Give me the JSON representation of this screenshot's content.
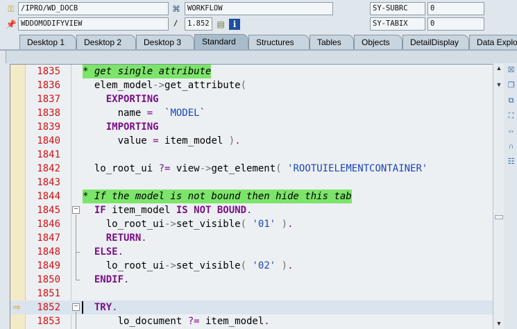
{
  "debugger": {
    "row1": {
      "program": "/IPRO/WD_DOCB",
      "event": "WORKFLOW",
      "sys_field_name": "SY-SUBRC",
      "sys_field_value": "0"
    },
    "row2": {
      "include": "WDDOMODIFYVIEW",
      "separator": "/",
      "line_no": "1.852",
      "sys_field_name": "SY-TABIX",
      "sys_field_value": "0"
    }
  },
  "tabs": [
    "Desktop 1",
    "Desktop 2",
    "Desktop 3",
    "Standard",
    "Structures",
    "Tables",
    "Objects",
    "DetailDisplay",
    "Data Explor"
  ],
  "active_tab": "Standard",
  "editor": {
    "lines": [
      {
        "no": "1835",
        "code": "* get single attribute"
      },
      {
        "no": "1836",
        "code": "  elem_model->get_attribute("
      },
      {
        "no": "1837",
        "code": "    EXPORTING"
      },
      {
        "no": "1838",
        "code": "      name =  `MODEL`"
      },
      {
        "no": "1839",
        "code": "    IMPORTING"
      },
      {
        "no": "1840",
        "code": "      value = item_model )."
      },
      {
        "no": "1841",
        "code": ""
      },
      {
        "no": "1842",
        "code": "  lo_root_ui ?= view->get_element( 'ROOTUIELEMENTCONTAINER'"
      },
      {
        "no": "1843",
        "code": ""
      },
      {
        "no": "1844",
        "code": "* If the model is not bound then hide this tab"
      },
      {
        "no": "1845",
        "code": "  IF item_model IS NOT BOUND."
      },
      {
        "no": "1846",
        "code": "    lo_root_ui->set_visible( '01' )."
      },
      {
        "no": "1847",
        "code": "    RETURN."
      },
      {
        "no": "1848",
        "code": "  ELSE."
      },
      {
        "no": "1849",
        "code": "    lo_root_ui->set_visible( '02' )."
      },
      {
        "no": "1850",
        "code": "  ENDIF."
      },
      {
        "no": "1851",
        "code": ""
      },
      {
        "no": "1852",
        "code": "  TRY."
      },
      {
        "no": "1853",
        "code": "      lo_document ?= item_model."
      }
    ],
    "current_line": "1852"
  },
  "colors": {
    "line_number": "#d31212",
    "keyword": "#7a0f85",
    "string": "#1c44b5",
    "comment_bg": "#7ce46a",
    "editor_bg": "#ecf0f3",
    "gutter_bg": "#f3ebc8"
  },
  "icons": {
    "program": "yellow-lock-icon",
    "include": "pin-icon",
    "event": "workflow-icon",
    "line": "source-icon",
    "info": "info-icon",
    "breakpoint_arrow": "execution-arrow-icon"
  }
}
